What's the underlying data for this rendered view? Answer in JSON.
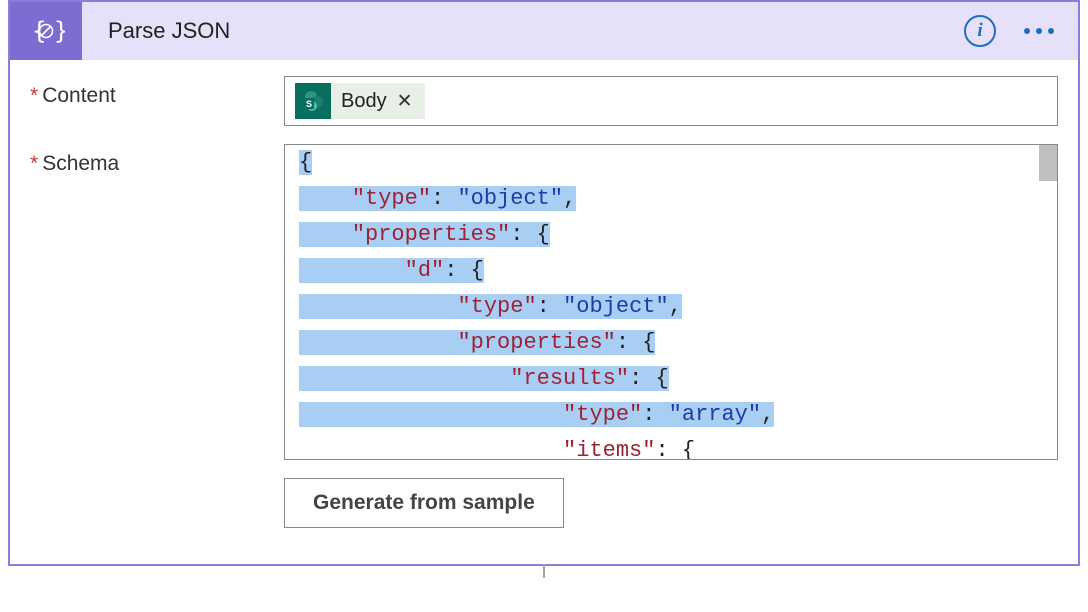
{
  "header": {
    "title": "Parse JSON"
  },
  "fields": {
    "content": {
      "label": "Content",
      "token_label": "Body",
      "token_remove": "✕"
    },
    "schema": {
      "label": "Schema",
      "json": {
        "l0": "{",
        "l1_indent": "    ",
        "l1_key": "\"type\"",
        "l1_colon": ": ",
        "l1_val": "\"object\"",
        "l1_comma": ",",
        "l2_indent": "    ",
        "l2_key": "\"properties\"",
        "l2_colon": ": ",
        "l2_brace": "{",
        "l3_indent": "        ",
        "l3_key": "\"d\"",
        "l3_colon": ": ",
        "l3_brace": "{",
        "l4_indent": "            ",
        "l4_key": "\"type\"",
        "l4_colon": ": ",
        "l4_val": "\"object\"",
        "l4_comma": ",",
        "l5_indent": "            ",
        "l5_key": "\"properties\"",
        "l5_colon": ": ",
        "l5_brace": "{",
        "l6_indent": "                ",
        "l6_key": "\"results\"",
        "l6_colon": ": ",
        "l6_brace": "{",
        "l7_indent": "                    ",
        "l7_key": "\"type\"",
        "l7_colon": ": ",
        "l7_val": "\"array\"",
        "l7_comma": ",",
        "l8_indent": "                    ",
        "l8_key": "\"items\"",
        "l8_colon": ": ",
        "l8_brace": "{"
      }
    },
    "generate_button": "Generate from sample"
  }
}
